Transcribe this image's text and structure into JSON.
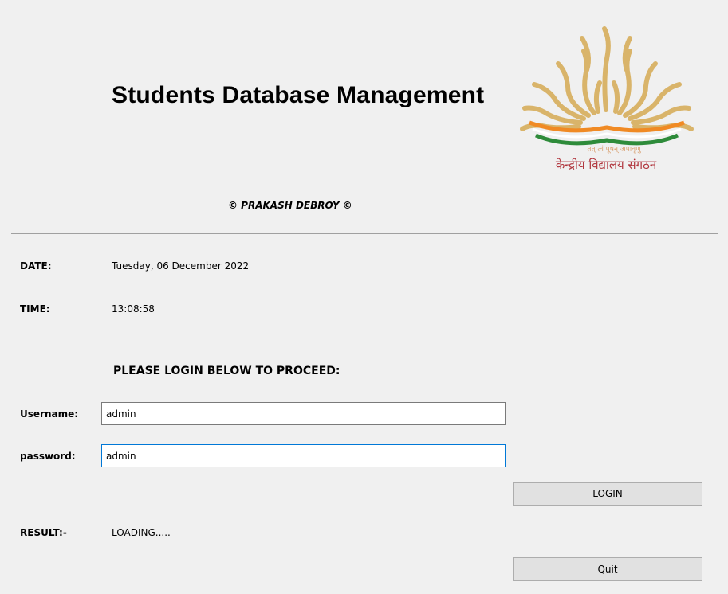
{
  "header": {
    "title": "Students Database Management",
    "copyright": "© PRAKASH DEBROY ©",
    "logo": {
      "motto": "तत् त्वं पूषन् अपावृणु",
      "org_name": "केन्द्रीय विद्यालय संगठन"
    }
  },
  "info": {
    "date_label": "DATE:",
    "date_value": "Tuesday, 06 December 2022",
    "time_label": "TIME:",
    "time_value": "13:08:58"
  },
  "login": {
    "heading": "PLEASE LOGIN BELOW TO PROCEED:",
    "username_label": "Username:",
    "username_value": "admin",
    "password_label": "password:",
    "password_value": "admin",
    "login_button": "LOGIN"
  },
  "result": {
    "label": "RESULT:-",
    "value": "LOADING....."
  },
  "quit_button": "Quit",
  "colors": {
    "background": "#f0f0f0",
    "logo_rays": "#d9b46a",
    "logo_saffron": "#f08a24",
    "logo_green": "#2e8b3a",
    "logo_text": "#b0343c",
    "focus_border": "#0078d7"
  }
}
